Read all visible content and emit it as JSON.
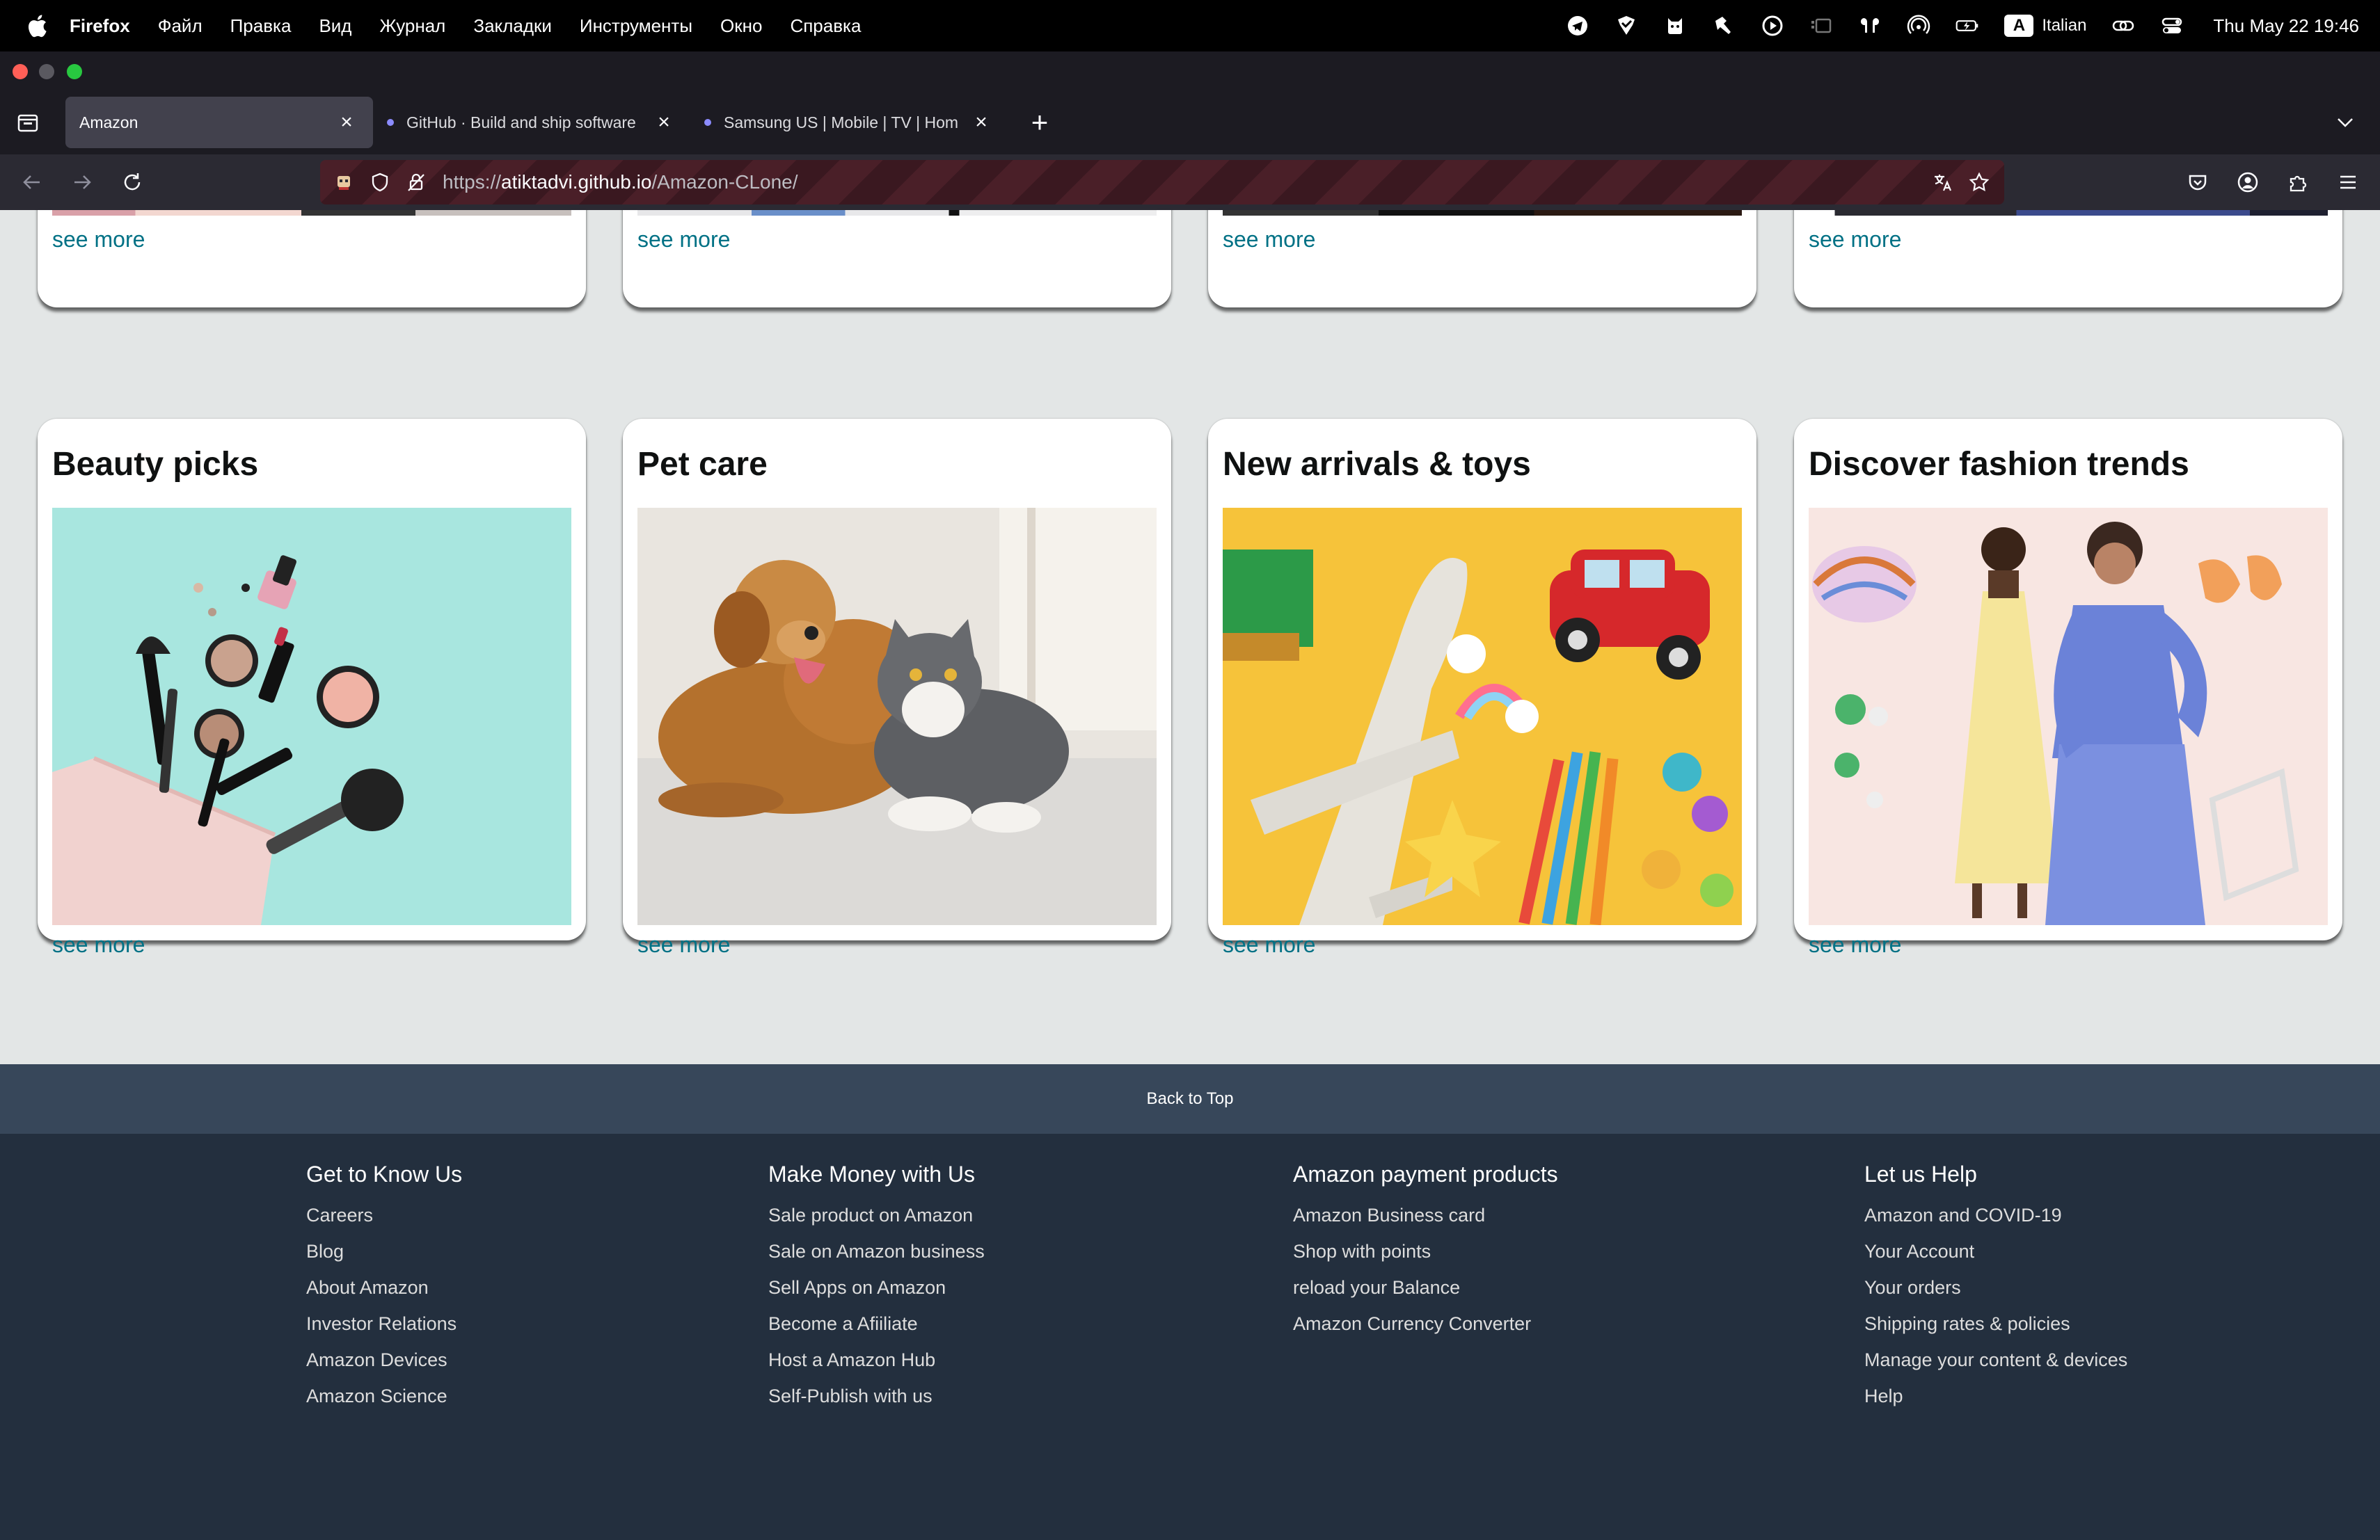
{
  "menubar": {
    "app_name": "Firefox",
    "items": [
      "Файл",
      "Правка",
      "Вид",
      "Журнал",
      "Закладки",
      "Инструменты",
      "Окно",
      "Справка"
    ],
    "keyboard_letter": "A",
    "input_language": "Italian",
    "clock": "Thu May 22  19:46"
  },
  "tabs": [
    {
      "title": "Amazon",
      "active": true
    },
    {
      "title": "GitHub · Build and ship software",
      "active": false
    },
    {
      "title": "Samsung US | Mobile | TV | Hom",
      "active": false
    }
  ],
  "urlbar": {
    "scheme": "https://",
    "host": "atiktadvi.github.io",
    "path": "/Amazon-CLone/"
  },
  "top_row": {
    "cards": [
      {
        "see_more": "see more"
      },
      {
        "see_more": "see more"
      },
      {
        "see_more": "see more"
      },
      {
        "see_more": "see more"
      }
    ]
  },
  "cards": [
    {
      "title": "Beauty picks",
      "see_more": "see more",
      "image": "makeup-products-image"
    },
    {
      "title": "Pet care",
      "see_more": "see more",
      "image": "dog-and-cat-image"
    },
    {
      "title": "New arrivals & toys",
      "see_more": "see more",
      "image": "toys-image"
    },
    {
      "title": "Discover fashion trends",
      "see_more": "see more",
      "image": "fashion-models-image"
    }
  ],
  "back_to_top": "Back to Top",
  "footer": {
    "columns": [
      {
        "heading": "Get to Know Us",
        "links": [
          "Careers",
          "Blog",
          "About Amazon",
          "Investor Relations",
          "Amazon Devices",
          "Amazon Science"
        ]
      },
      {
        "heading": "Make Money with Us",
        "links": [
          "Sale product on Amazon",
          "Sale on Amazon business",
          "Sell Apps on Amazon",
          "Become a Afiiliate",
          "Host a Amazon Hub",
          "Self-Publish with us"
        ]
      },
      {
        "heading": "Amazon payment products",
        "links": [
          "Amazon Business card",
          "Shop with points",
          "reload your Balance",
          "Amazon Currency Converter"
        ]
      },
      {
        "heading": "Let us Help",
        "links": [
          "Amazon and COVID-19",
          "Your Account",
          "Your orders",
          "Shipping rates & policies",
          "Manage your content & devices",
          "Help"
        ]
      }
    ]
  },
  "colors": {
    "page_bg": "#e3e6e6",
    "link": "#007185",
    "back_to_top_bg": "#37475a",
    "footer_bg": "#232f3e"
  }
}
